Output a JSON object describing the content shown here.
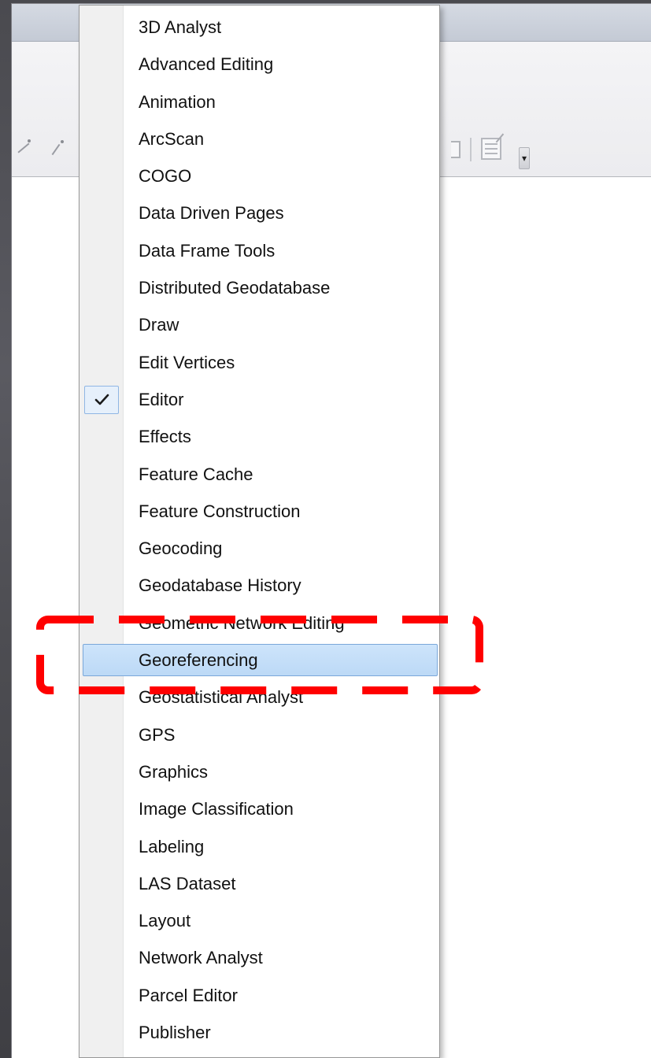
{
  "toolbar": {
    "overflow_glyph": "▾"
  },
  "toolbars_menu": {
    "items": [
      {
        "label": "3D Analyst",
        "checked": false,
        "highlighted": false
      },
      {
        "label": "Advanced Editing",
        "checked": false,
        "highlighted": false
      },
      {
        "label": "Animation",
        "checked": false,
        "highlighted": false
      },
      {
        "label": "ArcScan",
        "checked": false,
        "highlighted": false
      },
      {
        "label": "COGO",
        "checked": false,
        "highlighted": false
      },
      {
        "label": "Data Driven Pages",
        "checked": false,
        "highlighted": false
      },
      {
        "label": "Data Frame Tools",
        "checked": false,
        "highlighted": false
      },
      {
        "label": "Distributed Geodatabase",
        "checked": false,
        "highlighted": false
      },
      {
        "label": "Draw",
        "checked": false,
        "highlighted": false
      },
      {
        "label": "Edit Vertices",
        "checked": false,
        "highlighted": false
      },
      {
        "label": "Editor",
        "checked": true,
        "highlighted": false
      },
      {
        "label": "Effects",
        "checked": false,
        "highlighted": false
      },
      {
        "label": "Feature Cache",
        "checked": false,
        "highlighted": false
      },
      {
        "label": "Feature Construction",
        "checked": false,
        "highlighted": false
      },
      {
        "label": "Geocoding",
        "checked": false,
        "highlighted": false
      },
      {
        "label": "Geodatabase History",
        "checked": false,
        "highlighted": false
      },
      {
        "label": "Geometric Network Editing",
        "checked": false,
        "highlighted": false
      },
      {
        "label": "Georeferencing",
        "checked": false,
        "highlighted": true
      },
      {
        "label": "Geostatistical Analyst",
        "checked": false,
        "highlighted": false
      },
      {
        "label": "GPS",
        "checked": false,
        "highlighted": false
      },
      {
        "label": "Graphics",
        "checked": false,
        "highlighted": false
      },
      {
        "label": "Image Classification",
        "checked": false,
        "highlighted": false
      },
      {
        "label": "Labeling",
        "checked": false,
        "highlighted": false
      },
      {
        "label": "LAS Dataset",
        "checked": false,
        "highlighted": false
      },
      {
        "label": "Layout",
        "checked": false,
        "highlighted": false
      },
      {
        "label": "Network Analyst",
        "checked": false,
        "highlighted": false
      },
      {
        "label": "Parcel Editor",
        "checked": false,
        "highlighted": false
      },
      {
        "label": "Publisher",
        "checked": false,
        "highlighted": false
      }
    ]
  },
  "colors": {
    "highlight_fill": "#c4dff8",
    "highlight_border": "#7aa7d9",
    "annotation_red": "#ff0000",
    "menu_text": "#111111",
    "gutter": "#f0f0f0"
  },
  "icons": {
    "check": "check-icon",
    "overflow": "toolbar-overflow-icon"
  }
}
